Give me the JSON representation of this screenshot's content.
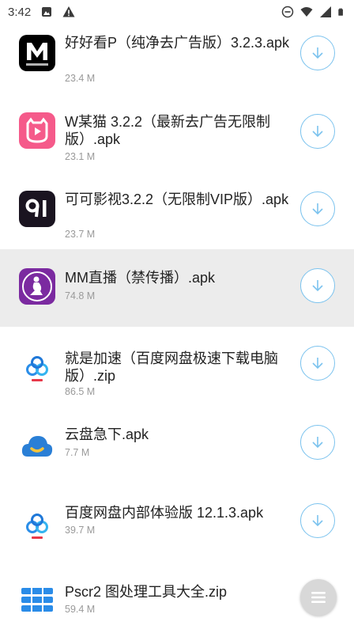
{
  "status_bar": {
    "time": "3:42"
  },
  "files": [
    {
      "title": "好好看P（纯净去广告版）3.2.3.apk",
      "size": "23.4 M",
      "icon": "m-logo-icon",
      "highlighted": false
    },
    {
      "title": "W某猫 3.2.2（最新去广告无限制版）.apk",
      "size": "23.1 M",
      "icon": "cat-play-icon",
      "highlighted": false
    },
    {
      "title": "可可影视3.2.2（无限制VIP版）.apk",
      "size": "23.7 M",
      "icon": "91-logo-icon",
      "highlighted": false
    },
    {
      "title": "MM直播（禁传播）.apk",
      "size": "74.8 M",
      "icon": "mm-live-icon",
      "highlighted": true
    },
    {
      "title": "就是加速（百度网盘极速下载电脑版）.zip",
      "size": "86.5 M",
      "icon": "baidu-pan-icon",
      "highlighted": false
    },
    {
      "title": "云盘急下.apk",
      "size": "7.7 M",
      "icon": "cloud-icon",
      "highlighted": false
    },
    {
      "title": "百度网盘内部体验版 12.1.3.apk",
      "size": "39.7 M",
      "icon": "baidu-pan-icon",
      "highlighted": false
    },
    {
      "title": "Pscr2 图处理工具大全.zip",
      "size": "59.4 M",
      "icon": "blue-bars-icon",
      "highlighted": false
    }
  ],
  "colors": {
    "accent": "#7cc3ee",
    "highlight_row": "#ececec"
  }
}
